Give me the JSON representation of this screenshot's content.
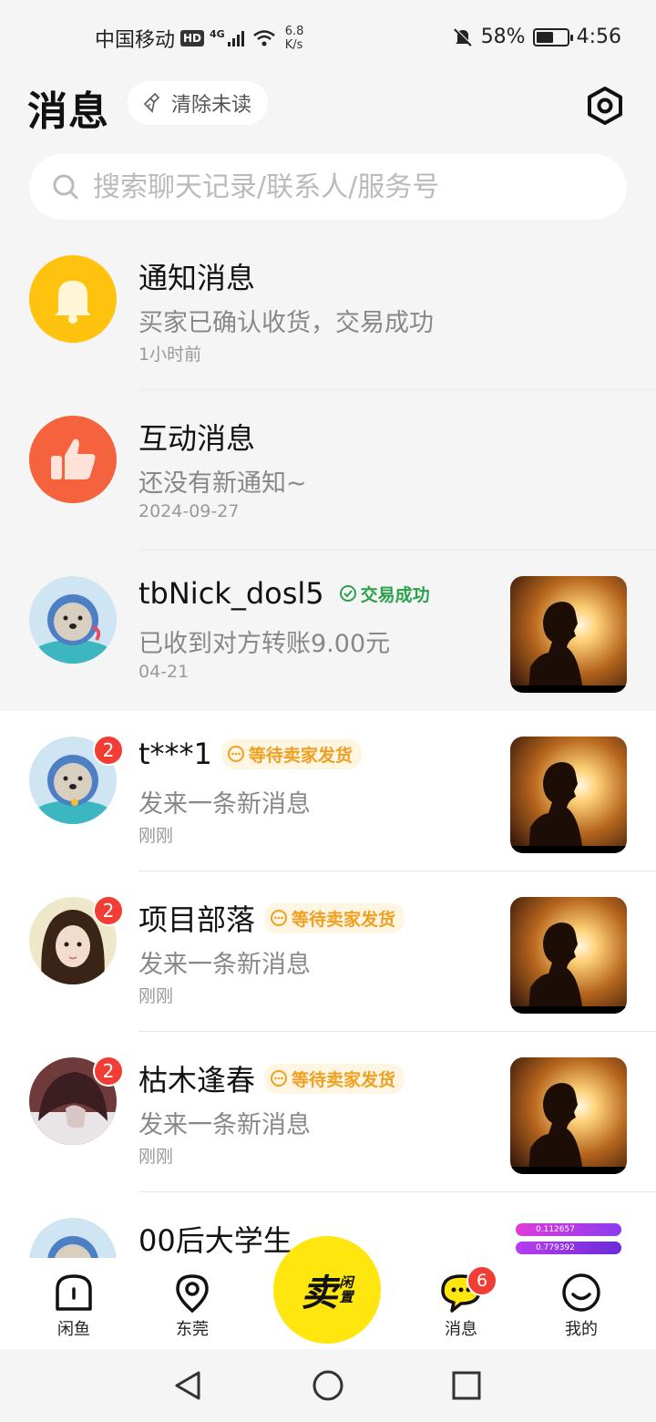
{
  "status_bar": {
    "carrier": "中国移动",
    "hd": "HD",
    "network": "4G",
    "speed_value": "6.8",
    "speed_unit": "K/s",
    "battery": "58%",
    "battery_level": 0.58,
    "time": "4:56"
  },
  "header": {
    "title": "消息",
    "clear_unread": "清除未读"
  },
  "search": {
    "placeholder": "搜索聊天记录/联系人/服务号"
  },
  "conversations": [
    {
      "name": "通知消息",
      "preview": "买家已确认收货，交易成功",
      "time": "1小时前",
      "avatar": "bell-icon"
    },
    {
      "name": "互动消息",
      "preview": "还没有新通知~",
      "time": "2024-09-27",
      "avatar": "thumbs-up-icon"
    },
    {
      "name": "tbNick_dosl5",
      "tag": "交易成功",
      "preview": "已收到对方转账9.00元",
      "time": "04-21"
    },
    {
      "name": "t***1",
      "tag": "等待卖家发货",
      "preview": "发来一条新消息",
      "time": "刚刚",
      "unread": "2"
    },
    {
      "name": "项目部落",
      "tag": "等待卖家发货",
      "preview": "发来一条新消息",
      "time": "刚刚",
      "unread": "2"
    },
    {
      "name": "枯木逢春",
      "tag": "等待卖家发货",
      "preview": "发来一条新消息",
      "time": "刚刚",
      "unread": "2"
    },
    {
      "name": "00后大学生",
      "thumb_line1": "0.112657",
      "thumb_line2": "0.779392"
    }
  ],
  "bottom_nav": {
    "home": "闲鱼",
    "local": "东莞",
    "sell_main": "卖",
    "sell_sub1": "闲",
    "sell_sub2": "置",
    "messages": "消息",
    "messages_badge": "6",
    "mine": "我的"
  },
  "colors": {
    "accent_yellow": "#ffe60f",
    "badge_red": "#f23d34",
    "success_green": "#2ca14b",
    "pending_orange": "#f0a020"
  }
}
